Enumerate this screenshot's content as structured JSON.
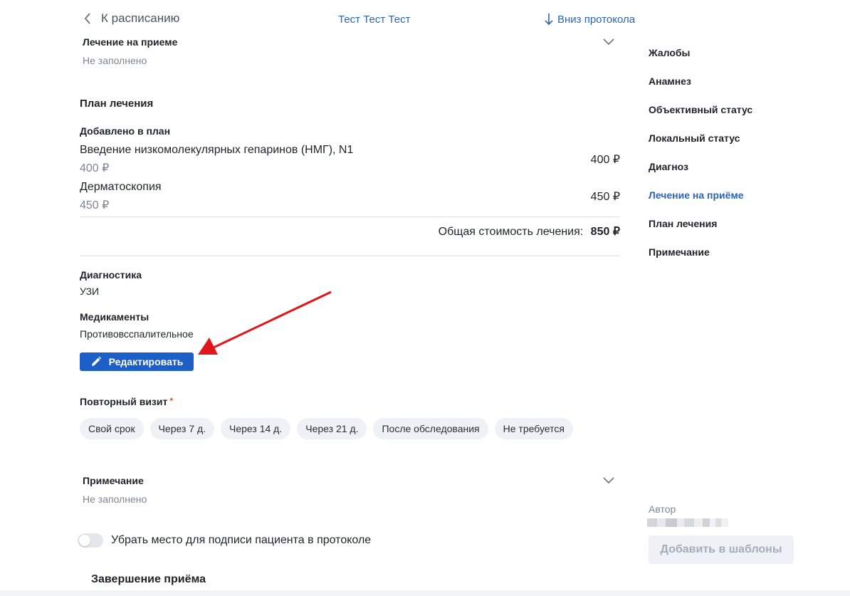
{
  "header": {
    "back_label": "К расписанию",
    "patient_name": "Тест Тест Тест",
    "down_label": "Вниз протокола"
  },
  "treatment_at_visit": {
    "title": "Лечение на приеме",
    "value": "Не заполнено"
  },
  "plan": {
    "title": "План лечения",
    "added_label": "Добавлено в план",
    "items": [
      {
        "name": "Введение низкомолекулярных гепаринов (НМГ), N1",
        "price": "400 ₽",
        "price_right": "400 ₽"
      },
      {
        "name": "Дерматоскопия",
        "price": "450 ₽",
        "price_right": "450 ₽"
      }
    ],
    "total_label": "Общая стоимость лечения:",
    "total_value": "850 ₽"
  },
  "diagnostics": {
    "title": "Диагностика",
    "value": "УЗИ"
  },
  "medications": {
    "title": "Медикаменты",
    "value": "Противовсспалительное"
  },
  "edit_button": "Редактировать",
  "repeat_visit": {
    "title": "Повторный визит",
    "required_mark": "*",
    "options": [
      "Свой срок",
      "Через 7 д.",
      "Через 14 д.",
      "Через 21 д.",
      "После обследования",
      "Не требуется"
    ]
  },
  "note": {
    "title": "Примечание",
    "value": "Не заполнено"
  },
  "signature_toggle": {
    "label": "Убрать место для подписи пациента в протоколе",
    "on": false
  },
  "finish_title": "Завершение приёма",
  "sidebar": {
    "items": [
      {
        "label": "Жалобы",
        "active": false
      },
      {
        "label": "Анамнез",
        "active": false
      },
      {
        "label": "Объективный статус",
        "active": false
      },
      {
        "label": "Локальный статус",
        "active": false
      },
      {
        "label": "Диагноз",
        "active": false
      },
      {
        "label": "Лечение на приёме",
        "active": true
      },
      {
        "label": "План лечения",
        "active": false
      },
      {
        "label": "Примечание",
        "active": false
      }
    ],
    "author_label": "Автор",
    "templates_button": "Добавить в шаблоны"
  },
  "colors": {
    "accent": "#2d63b7",
    "button_primary": "#1c5fc7",
    "annotation_arrow": "#e0161b",
    "required": "#e14a3b"
  },
  "icons": [
    "back-chevron-icon",
    "arrow-down-icon",
    "chevron-down-icon",
    "pencil-icon",
    "red-arrow-annotation"
  ]
}
